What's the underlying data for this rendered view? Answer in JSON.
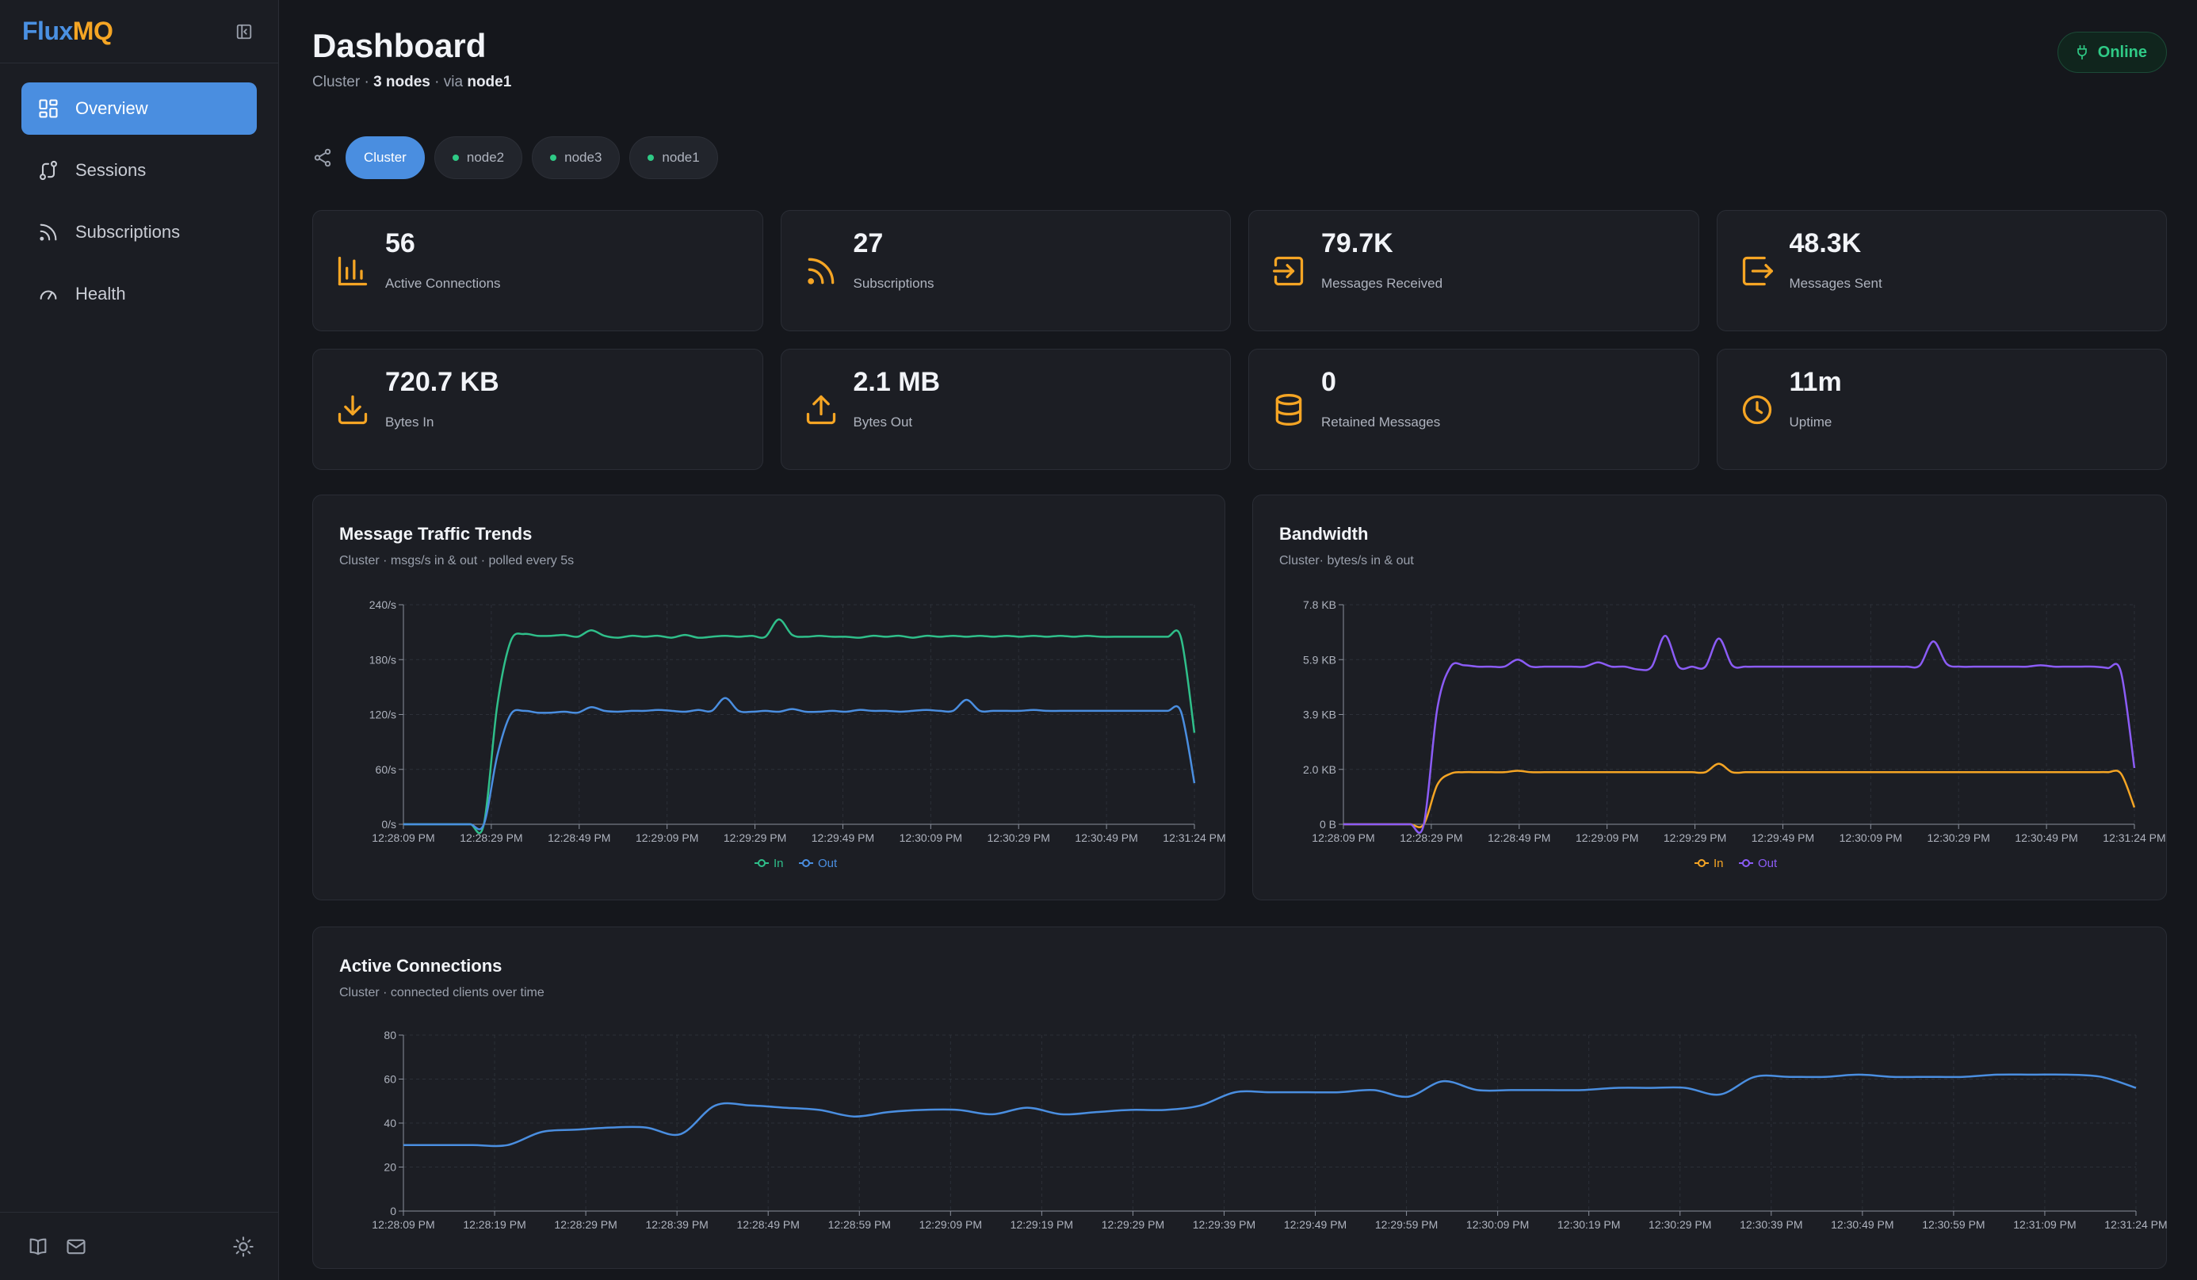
{
  "sidebar": {
    "brand_part1": "Flux",
    "brand_part2": "MQ",
    "items": [
      {
        "label": "Overview",
        "icon": "grid-icon",
        "active": true
      },
      {
        "label": "Sessions",
        "icon": "sessions-icon"
      },
      {
        "label": "Subscriptions",
        "icon": "rss-icon"
      },
      {
        "label": "Health",
        "icon": "gauge-icon"
      }
    ],
    "footer_icons": [
      "book-icon",
      "mail-icon",
      "sun-icon"
    ]
  },
  "header": {
    "title": "Dashboard",
    "subtitle_prefix": "Cluster · ",
    "subtitle_nodes": "3 nodes",
    "subtitle_via": " · via ",
    "subtitle_node": "node1",
    "status": "Online"
  },
  "nodes": [
    {
      "label": "Cluster",
      "active": true
    },
    {
      "label": "node2",
      "online": true
    },
    {
      "label": "node3",
      "online": true
    },
    {
      "label": "node1",
      "online": true
    }
  ],
  "stats": [
    {
      "value": "56",
      "label": "Active Connections",
      "icon": "bar-chart-icon"
    },
    {
      "value": "27",
      "label": "Subscriptions",
      "icon": "rss-icon"
    },
    {
      "value": "79.7K",
      "label": "Messages Received",
      "icon": "inbox-arrow-icon"
    },
    {
      "value": "48.3K",
      "label": "Messages Sent",
      "icon": "outbox-arrow-icon"
    },
    {
      "value": "720.7 KB",
      "label": "Bytes In",
      "icon": "download-icon"
    },
    {
      "value": "2.1 MB",
      "label": "Bytes Out",
      "icon": "upload-icon"
    },
    {
      "value": "0",
      "label": "Retained Messages",
      "icon": "database-icon"
    },
    {
      "value": "11m",
      "label": "Uptime",
      "icon": "clock-icon"
    }
  ],
  "colors": {
    "accent": "#4a8ee0",
    "in": "#2fbf8a",
    "out": "#4a8ee0",
    "bw_in": "#f5a524",
    "bw_out": "#8b5cf6",
    "online": "#2fca86"
  },
  "chart_data": [
    {
      "id": "traffic",
      "type": "line",
      "title": "Message Traffic Trends",
      "subtitle": "Cluster · msgs/s in & out · polled every 5s",
      "y_ticks": [
        "0/s",
        "60/s",
        "120/s",
        "180/s",
        "240/s"
      ],
      "ylim": [
        0,
        240
      ],
      "x_ticks": [
        "12:28:09 PM",
        "12:28:29 PM",
        "12:28:49 PM",
        "12:29:09 PM",
        "12:29:29 PM",
        "12:29:49 PM",
        "12:30:09 PM",
        "12:30:29 PM",
        "12:30:49 PM",
        "12:31:24 PM"
      ],
      "legend_position": "bottom-center",
      "series": [
        {
          "name": "In",
          "color": "#2fbf8a",
          "values": [
            0,
            0,
            0,
            0,
            0,
            0,
            0,
            130,
            200,
            208,
            206,
            206,
            207,
            205,
            212,
            206,
            204,
            206,
            205,
            206,
            204,
            207,
            204,
            205,
            206,
            205,
            206,
            205,
            224,
            207,
            205,
            206,
            205,
            205,
            204,
            206,
            205,
            206,
            204,
            206,
            205,
            206,
            205,
            206,
            205,
            206,
            205,
            206,
            205,
            206,
            205,
            206,
            205,
            205,
            205,
            205,
            205,
            205,
            204,
            100
          ]
        },
        {
          "name": "Out",
          "color": "#4a8ee0",
          "values": [
            0,
            0,
            0,
            0,
            0,
            0,
            0,
            75,
            120,
            124,
            122,
            122,
            123,
            122,
            128,
            124,
            123,
            124,
            124,
            125,
            124,
            123,
            125,
            124,
            138,
            124,
            123,
            124,
            123,
            126,
            123,
            123,
            124,
            123,
            125,
            124,
            124,
            123,
            124,
            125,
            124,
            124,
            136,
            124,
            124,
            124,
            124,
            125,
            124,
            124,
            124,
            124,
            124,
            124,
            124,
            124,
            124,
            124,
            123,
            45
          ]
        }
      ]
    },
    {
      "id": "bandwidth",
      "type": "line",
      "title": "Bandwidth",
      "subtitle": "Cluster· bytes/s in & out",
      "y_ticks": [
        "0 B",
        "2.0 KB",
        "3.9 KB",
        "5.9 KB",
        "7.8 KB"
      ],
      "ylim": [
        0,
        7.8
      ],
      "x_ticks": [
        "12:28:09 PM",
        "12:28:29 PM",
        "12:28:49 PM",
        "12:29:09 PM",
        "12:29:29 PM",
        "12:29:49 PM",
        "12:30:09 PM",
        "12:30:29 PM",
        "12:30:49 PM",
        "12:31:24 PM"
      ],
      "legend_position": "bottom-center",
      "series": [
        {
          "name": "In",
          "color": "#f5a524",
          "values": [
            0,
            0,
            0,
            0,
            0,
            0,
            0,
            1.4,
            1.8,
            1.85,
            1.85,
            1.85,
            1.85,
            1.9,
            1.85,
            1.85,
            1.85,
            1.85,
            1.85,
            1.85,
            1.85,
            1.85,
            1.85,
            1.85,
            1.85,
            1.85,
            1.85,
            1.85,
            2.15,
            1.85,
            1.85,
            1.85,
            1.85,
            1.85,
            1.85,
            1.85,
            1.85,
            1.85,
            1.85,
            1.85,
            1.85,
            1.85,
            1.85,
            1.85,
            1.85,
            1.85,
            1.85,
            1.85,
            1.85,
            1.85,
            1.85,
            1.85,
            1.85,
            1.85,
            1.85,
            1.85,
            1.85,
            1.85,
            1.8,
            0.6
          ]
        },
        {
          "name": "Out",
          "color": "#8b5cf6",
          "values": [
            0,
            0,
            0,
            0,
            0,
            0,
            0,
            4.1,
            5.6,
            5.65,
            5.6,
            5.6,
            5.6,
            5.85,
            5.6,
            5.6,
            5.6,
            5.6,
            5.6,
            5.75,
            5.6,
            5.6,
            5.5,
            5.6,
            6.7,
            5.6,
            5.6,
            5.6,
            6.6,
            5.65,
            5.6,
            5.6,
            5.6,
            5.6,
            5.6,
            5.6,
            5.6,
            5.6,
            5.6,
            5.6,
            5.6,
            5.6,
            5.6,
            5.65,
            6.5,
            5.7,
            5.6,
            5.6,
            5.6,
            5.6,
            5.6,
            5.6,
            5.65,
            5.6,
            5.6,
            5.6,
            5.6,
            5.55,
            5.4,
            2.0
          ]
        }
      ]
    },
    {
      "id": "connections",
      "type": "line",
      "title": "Active Connections",
      "subtitle": "Cluster · connected clients over time",
      "y_ticks": [
        "0",
        "20",
        "40",
        "60",
        "80"
      ],
      "ylim": [
        0,
        80
      ],
      "x_ticks": [
        "12:28:09 PM",
        "12:28:19 PM",
        "12:28:29 PM",
        "12:28:39 PM",
        "12:28:49 PM",
        "12:28:59 PM",
        "12:29:09 PM",
        "12:29:19 PM",
        "12:29:29 PM",
        "12:29:39 PM",
        "12:29:49 PM",
        "12:29:59 PM",
        "12:30:09 PM",
        "12:30:19 PM",
        "12:30:29 PM",
        "12:30:39 PM",
        "12:30:49 PM",
        "12:30:59 PM",
        "12:31:09 PM",
        "12:31:24 PM"
      ],
      "legend_position": "none",
      "series": [
        {
          "name": "",
          "color": "#4a8ee0",
          "values": [
            30,
            30,
            30,
            30,
            36,
            37,
            38,
            38,
            35,
            48,
            48,
            47,
            46,
            43,
            45,
            46,
            46,
            44,
            47,
            44,
            45,
            46,
            46,
            48,
            54,
            54,
            54,
            54,
            55,
            52,
            59,
            55,
            55,
            55,
            55,
            56,
            56,
            56,
            53,
            61,
            61,
            61,
            62,
            61,
            61,
            61,
            62,
            62,
            62,
            61,
            56
          ]
        }
      ]
    }
  ]
}
